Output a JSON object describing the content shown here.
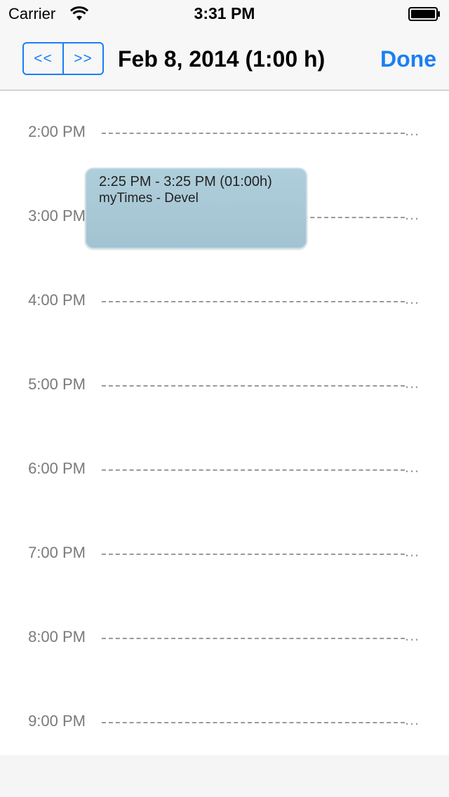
{
  "status_bar": {
    "carrier": "Carrier",
    "time": "3:31 PM"
  },
  "nav": {
    "prev_label": "<<",
    "next_label": ">>",
    "title": "Feb 8, 2014 (1:00 h)",
    "done_label": "Done",
    "accent_color": "#1a7ff5"
  },
  "timeline": {
    "hours": [
      {
        "label": "2:00 PM"
      },
      {
        "label": "3:00 PM"
      },
      {
        "label": "4:00 PM"
      },
      {
        "label": "5:00 PM"
      },
      {
        "label": "6:00 PM"
      },
      {
        "label": "7:00 PM"
      },
      {
        "label": "8:00 PM"
      },
      {
        "label": "9:00 PM"
      }
    ],
    "overflow": "…",
    "event": {
      "time_range": "2:25 PM - 3:25 PM (01:00h)",
      "title": "myTimes - Devel",
      "color": "#a9c9d6"
    }
  }
}
